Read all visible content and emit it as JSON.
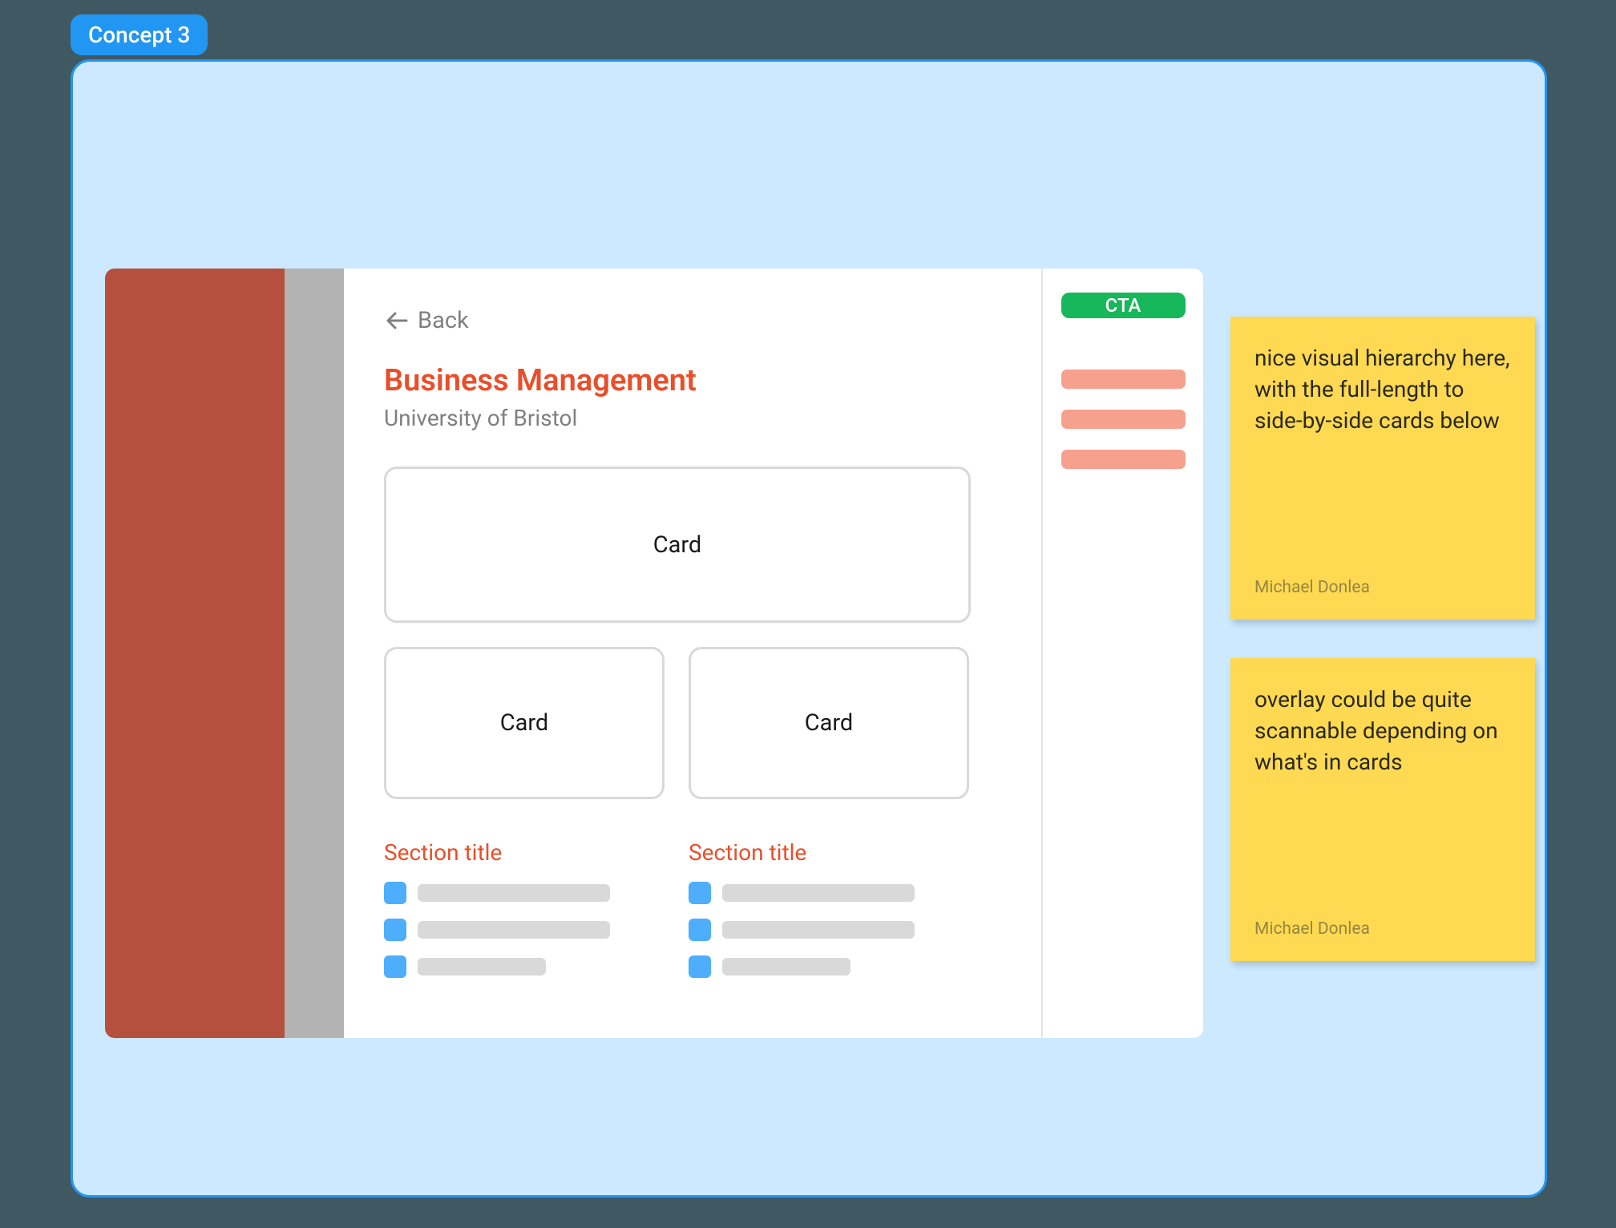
{
  "concept": {
    "badge": "Concept 3"
  },
  "mockup": {
    "back_label": "Back",
    "title": "Business Management",
    "subtitle": "University of Bristol",
    "card_full_label": "Card",
    "card_half_1_label": "Card",
    "card_half_2_label": "Card",
    "section_1_title": "Section title",
    "section_2_title": "Section title",
    "cta_label": "CTA"
  },
  "sticky_notes": [
    {
      "text": "nice visual hierarchy here, with the full-length to side-by-side cards below",
      "author": "Michael Donlea"
    },
    {
      "text": "overlay could be quite scannable depending on what's in cards",
      "author": "Michael Donlea"
    }
  ]
}
